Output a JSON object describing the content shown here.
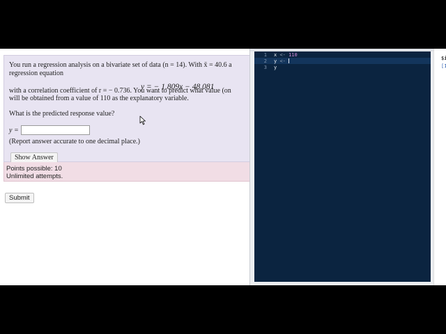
{
  "question": {
    "line1": "You run a regression analysis on a bivariate set of data (n = 14). With x̄ = 40.6 a",
    "line2": "regression equation",
    "equation": "y = − 1.809x − 48.081",
    "line3": "with a correlation coefficient of r = − 0.736. You want to predict what value (on",
    "line4": "will be obtained from a value of 110 as the explanatory variable.",
    "prompt": "What is the predicted response value?",
    "answer_label": "y =",
    "answer_value": "",
    "note": "(Report answer accurate to one decimal place.)",
    "show_answer_label": "Show Answer"
  },
  "points": {
    "possible": "Points possible: 10",
    "attempts": "Unlimited attempts."
  },
  "submit_label": "Submit",
  "editor": {
    "line_numbers": [
      "1",
      "2",
      "3"
    ],
    "lines": [
      {
        "var": "x",
        "op": "<-",
        "val": "110"
      },
      {
        "var": "y",
        "op": "<-",
        "val": ""
      },
      {
        "var": "y",
        "op": "",
        "val": ""
      }
    ],
    "colors": {
      "background": "#0b2440",
      "number": "#d48bd9"
    }
  },
  "right_panel": {
    "text1": "$i",
    "text2": "[1"
  }
}
